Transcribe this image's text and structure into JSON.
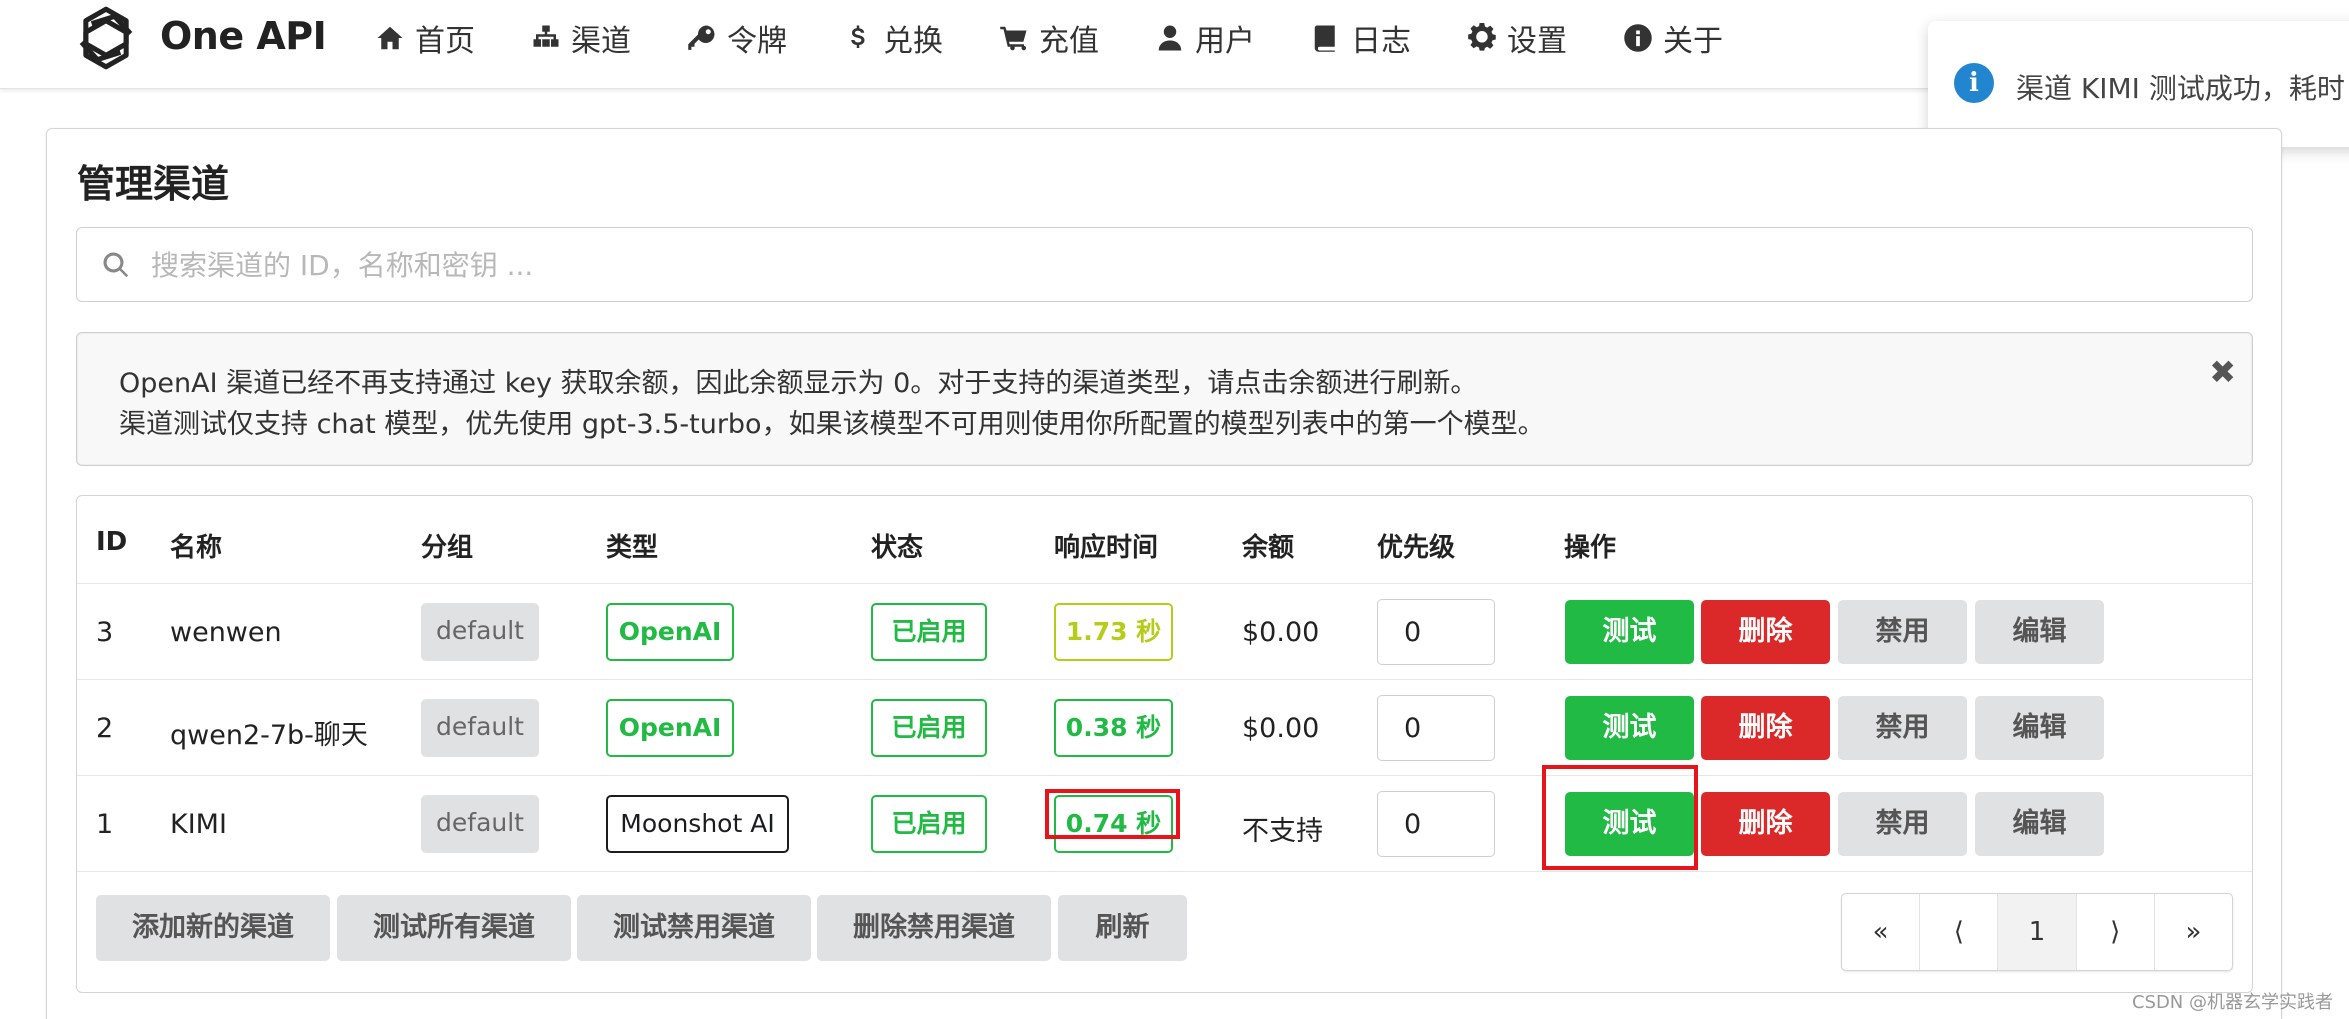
{
  "app": {
    "name": "One API"
  },
  "nav": [
    {
      "label": "首页",
      "icon": "home-icon"
    },
    {
      "label": "渠道",
      "icon": "sitemap-icon"
    },
    {
      "label": "令牌",
      "icon": "key-icon"
    },
    {
      "label": "兑换",
      "icon": "dollar-icon"
    },
    {
      "label": "充值",
      "icon": "cart-icon"
    },
    {
      "label": "用户",
      "icon": "user-icon"
    },
    {
      "label": "日志",
      "icon": "book-icon"
    },
    {
      "label": "设置",
      "icon": "gear-icon"
    },
    {
      "label": "关于",
      "icon": "info-circle-icon"
    }
  ],
  "toast": {
    "text": "渠道 KIMI 测试成功，耗时",
    "icon": "info-icon",
    "color": "#2185d0"
  },
  "page": {
    "title": "管理渠道"
  },
  "search": {
    "placeholder": "搜索渠道的 ID，名称和密钥 ..."
  },
  "notice": {
    "line1": "OpenAI 渠道已经不再支持通过 key 获取余额，因此余额显示为 0。对于支持的渠道类型，请点击余额进行刷新。",
    "line2": "渠道测试仅支持 chat 模型，优先使用 gpt-3.5-turbo，如果该模型不可用则使用你所配置的模型列表中的第一个模型。",
    "close": "✖"
  },
  "table": {
    "headers": {
      "id": "ID",
      "name": "名称",
      "group": "分组",
      "type": "类型",
      "status": "状态",
      "response": "响应时间",
      "balance": "余额",
      "priority": "优先级",
      "actions": "操作"
    },
    "rows": [
      {
        "id": "3",
        "name": "wenwen",
        "group": "default",
        "type": "OpenAI",
        "status": "已启用",
        "response": "1.73 秒",
        "balance": "$0.00",
        "priority": "0"
      },
      {
        "id": "2",
        "name": "qwen2-7b-聊天",
        "group": "default",
        "type": "OpenAI",
        "status": "已启用",
        "response": "0.38 秒",
        "balance": "$0.00",
        "priority": "0"
      },
      {
        "id": "1",
        "name": "KIMI",
        "group": "default",
        "type": "Moonshot AI",
        "status": "已启用",
        "response": "0.74 秒",
        "balance": "不支持",
        "priority": "0"
      }
    ],
    "actions": {
      "test": "测试",
      "delete": "删除",
      "disable": "禁用",
      "edit": "编辑"
    }
  },
  "footer_buttons": {
    "add": "添加新的渠道",
    "test_all": "测试所有渠道",
    "test_disabled": "测试禁用渠道",
    "delete_disabled": "删除禁用渠道",
    "refresh": "刷新"
  },
  "pagination": {
    "first": "«",
    "prev": "⟨",
    "current": "1",
    "next": "⟩",
    "last": "»"
  },
  "watermark": "CSDN @机器玄学实践者",
  "colors": {
    "green": "#21ba45",
    "red": "#db2828",
    "olive": "#b5cc18",
    "highlight": "#e8141b",
    "blue": "#2185d0"
  }
}
